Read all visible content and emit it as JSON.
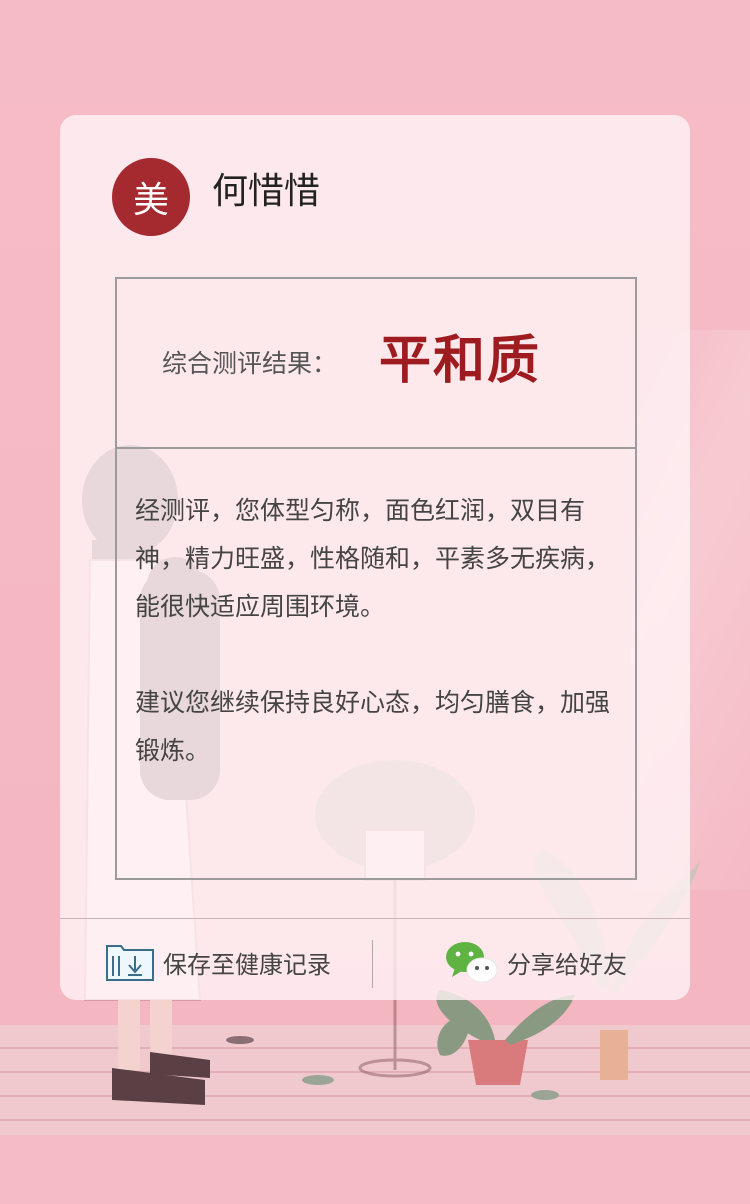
{
  "profile": {
    "avatar_text": "美",
    "name": "何惜惜"
  },
  "result": {
    "label": "综合测评结果：",
    "value": "平和质",
    "description": "经测评，您体型匀称，面色红润，双目有神，精力旺盛，性格随和，平素多无疾病，能很快适应周围环境。",
    "advice": "建议您继续保持良好心态，均匀膳食，加强锻炼。"
  },
  "actions": {
    "save_label": "保存至健康记录",
    "share_label": "分享给好友"
  },
  "colors": {
    "background": "#f5bdc5",
    "accent": "#9e1c20",
    "avatar_bg": "#a52a2f",
    "wechat_green": "#5fb342"
  },
  "icons": {
    "save": "save-record-icon",
    "share": "wechat-icon"
  }
}
